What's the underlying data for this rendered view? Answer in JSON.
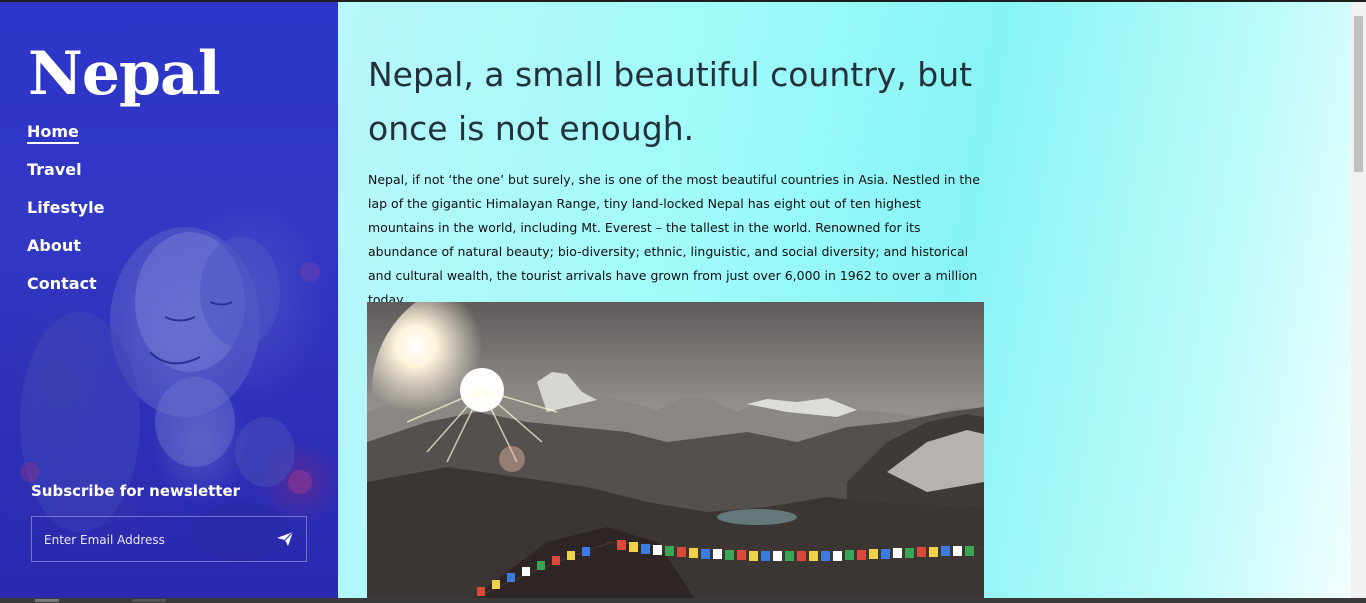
{
  "site": {
    "logo": "Nepal"
  },
  "nav": {
    "items": [
      {
        "label": "Home",
        "active": true
      },
      {
        "label": "Travel",
        "active": false
      },
      {
        "label": "Lifestyle",
        "active": false
      },
      {
        "label": "About",
        "active": false
      },
      {
        "label": "Contact",
        "active": false
      }
    ]
  },
  "newsletter": {
    "title": "Subscribe for newsletter",
    "placeholder": "Enter Email Address",
    "send_icon": "paper-plane-icon"
  },
  "article": {
    "headline": "Nepal, a small beautiful country, but once is not enough.",
    "intro": "Nepal, if not ‘the one’ but surely, she is one of the most beautiful countries in Asia. Nestled in the lap of the gigantic Himalayan Range, tiny land-locked Nepal has eight out of ten highest mountains in the world, including Mt. Everest – the tallest in the world. Renowned for its abundance of natural beauty; bio-diversity; ethnic, linguistic, and social diversity; and historical and cultural wealth, the tourist arrivals have grown from just over 6,000 in 1962 to over a million today."
  },
  "colors": {
    "sidebar": "#2d35c9",
    "main_gradient_start": "#b8f6fb",
    "main_gradient_end": "#f2ffff",
    "heading_text": "#23323a"
  }
}
